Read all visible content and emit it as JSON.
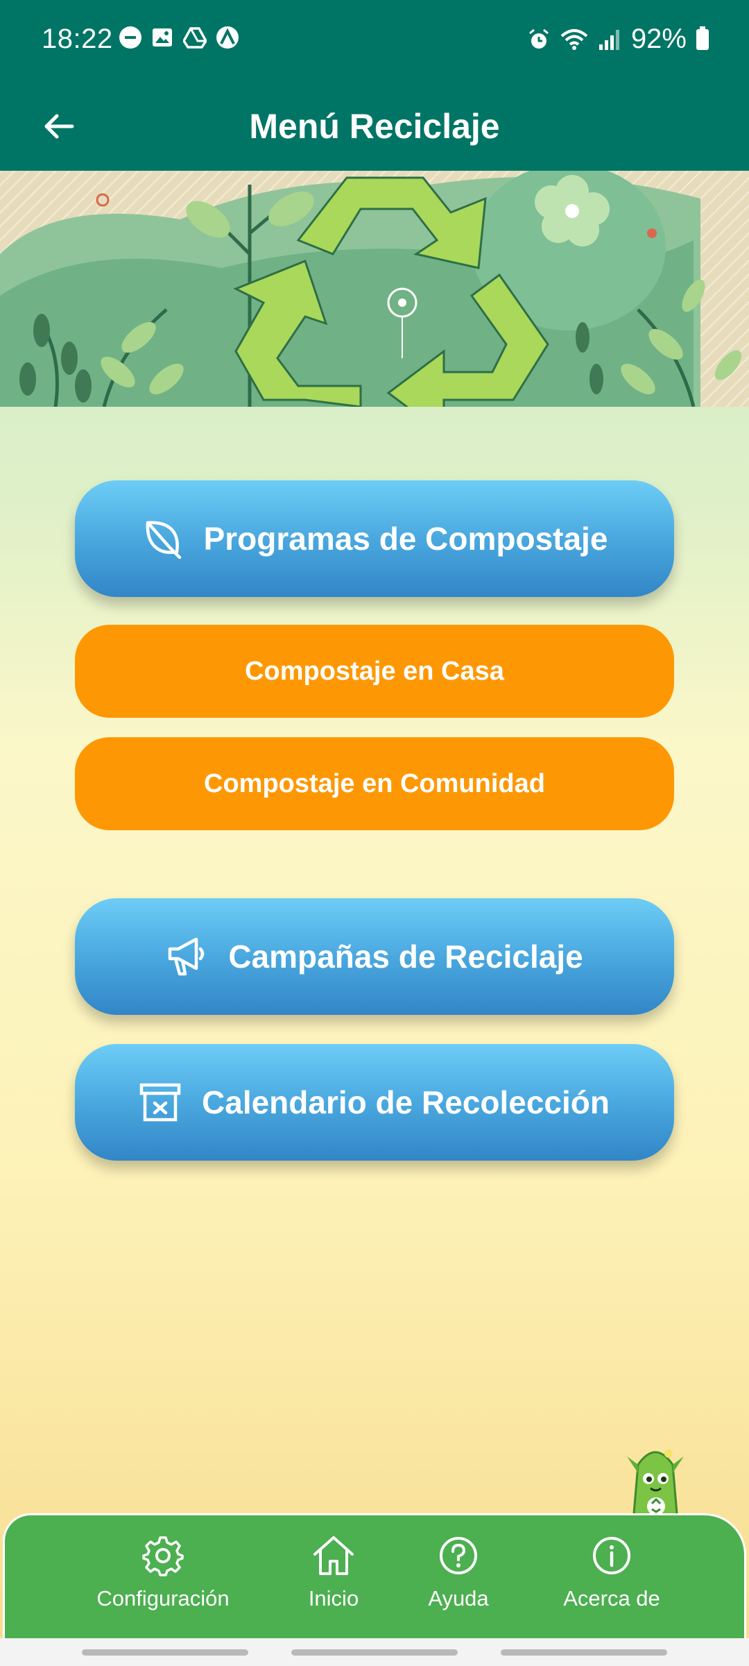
{
  "status_bar": {
    "time": "18:22",
    "battery": "92%"
  },
  "app_bar": {
    "title": "Menú Reciclaje",
    "back_icon": "arrow-left-icon"
  },
  "menu": {
    "programas": {
      "label": "Programas de Compostaje",
      "icon": "leaf-icon"
    },
    "compost_casa": {
      "label": "Compostaje en Casa"
    },
    "compost_comunidad": {
      "label": "Compostaje en Comunidad"
    },
    "campanas": {
      "label": "Campañas de Reciclaje",
      "icon": "megaphone-icon"
    },
    "calendario": {
      "label": "Calendario de Recolección",
      "icon": "trash-bin-icon"
    }
  },
  "bottom_nav": [
    {
      "label": "Configuración",
      "icon": "gear-icon"
    },
    {
      "label": "Inicio",
      "icon": "home-icon"
    },
    {
      "label": "Ayuda",
      "icon": "help-circle-icon"
    },
    {
      "label": "Acerca de",
      "icon": "info-circle-icon"
    }
  ],
  "colors": {
    "primary": "#017565",
    "button_blue": "#4aa8df",
    "button_orange": "#fd9804",
    "nav_green": "#4caf50"
  }
}
